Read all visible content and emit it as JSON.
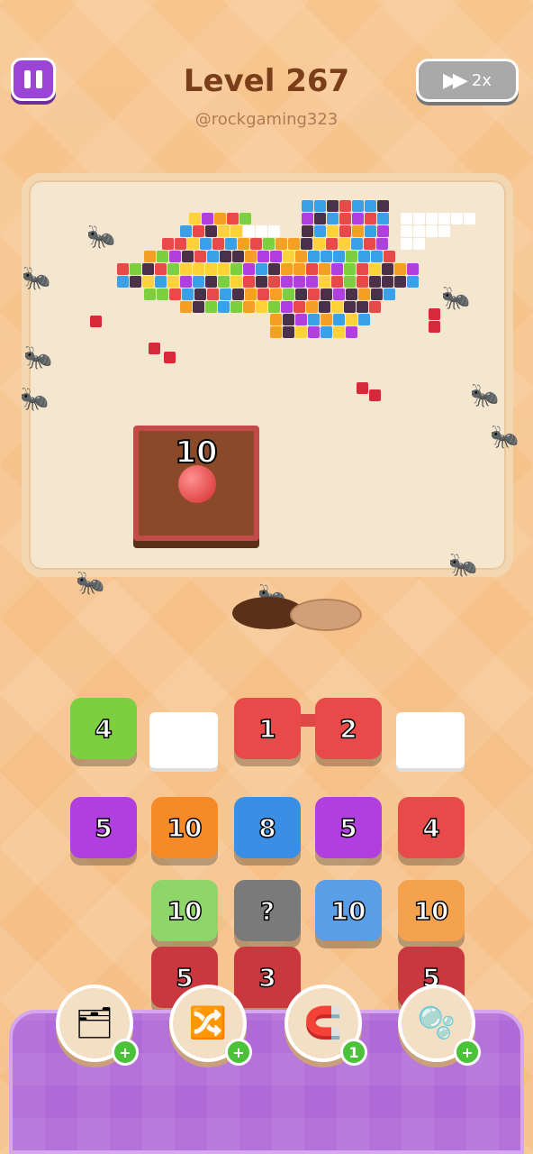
{
  "header": {
    "level_title": "Level 267",
    "username": "@rockgaming323",
    "speed_label": "2x"
  },
  "crate": {
    "count": "10"
  },
  "queue_row": [
    {
      "label": "4",
      "color": "#7ccf3f"
    },
    {
      "label": "1",
      "color": "#e84a4a"
    },
    {
      "label": "2",
      "color": "#e84a4a"
    }
  ],
  "grid_row1": [
    {
      "label": "5",
      "color": "#b13fe0"
    },
    {
      "label": "10",
      "color": "#f58a26"
    },
    {
      "label": "8",
      "color": "#3a8ee6"
    },
    {
      "label": "5",
      "color": "#b13fe0"
    },
    {
      "label": "4",
      "color": "#e84a4a"
    }
  ],
  "grid_row2": [
    {
      "label": "10",
      "color": "#8fd66a"
    },
    {
      "label": "?",
      "color": "#7a7a7a"
    },
    {
      "label": "10",
      "color": "#5a9ee8"
    },
    {
      "label": "10",
      "color": "#f5a24e"
    }
  ],
  "grid_row3": [
    {
      "label": "5",
      "color": "#c9373f"
    },
    {
      "label": "3",
      "color": "#c9373f"
    },
    {
      "label": "5",
      "color": "#c9373f"
    }
  ],
  "boosters": [
    {
      "icon": "add-box-icon",
      "badge": "+"
    },
    {
      "icon": "shuffle-arrows-icon",
      "badge": "+"
    },
    {
      "icon": "magnet-icon",
      "badge": "1"
    },
    {
      "icon": "bubble-icon",
      "badge": "+"
    }
  ]
}
